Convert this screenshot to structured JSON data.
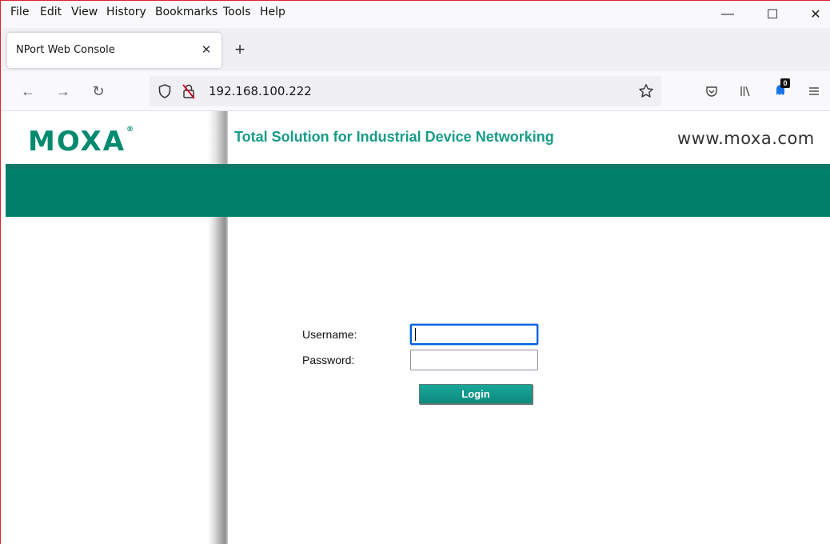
{
  "browser": {
    "menu": [
      "File",
      "Edit",
      "View",
      "History",
      "Bookmarks",
      "Tools",
      "Help"
    ],
    "window_controls": {
      "minimize": "—",
      "maximize": "☐",
      "close": "✕"
    },
    "tab": {
      "title": "NPort Web Console",
      "close_glyph": "✕"
    },
    "new_tab_glyph": "+",
    "nav": {
      "back": "←",
      "forward": "→",
      "reload": "↻"
    },
    "url": "192.168.100.222",
    "extension_badge_count": "0"
  },
  "page": {
    "logo_text": "MOXA",
    "logo_mark": "®",
    "tagline": "Total Solution for Industrial Device Networking",
    "site": "www.moxa.com",
    "brand_color": "#00806a",
    "login_form": {
      "username_label": "Username:",
      "username_value": "",
      "password_label": "Password:",
      "password_value": "",
      "login_button": "Login"
    }
  }
}
